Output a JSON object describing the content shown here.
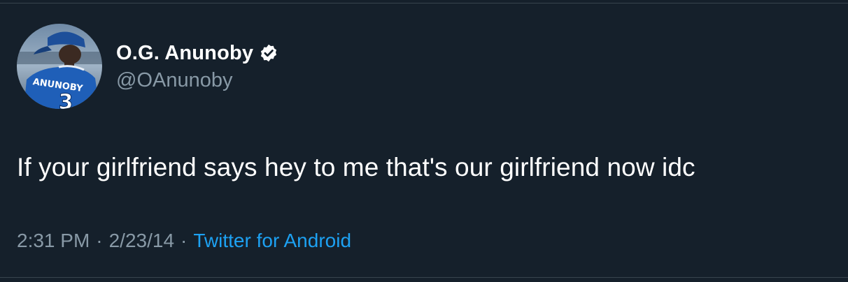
{
  "tweet": {
    "author": {
      "display_name": "O.G. Anunoby",
      "handle": "@OAnunoby",
      "verified": true,
      "avatar_jersey_name": "ANUNOBY",
      "avatar_jersey_number": "3"
    },
    "text": "If your girlfriend says hey to me that's our girlfriend now idc",
    "meta": {
      "time": "2:31 PM",
      "date": "2/23/14",
      "separator": "·",
      "source": "Twitter for Android"
    }
  },
  "colors": {
    "background": "#15202b",
    "primary_text": "#ffffff",
    "secondary_text": "#8899a6",
    "link": "#1da1f2",
    "divider": "#38444d"
  },
  "icons": {
    "verified": "verified-badge-icon"
  }
}
